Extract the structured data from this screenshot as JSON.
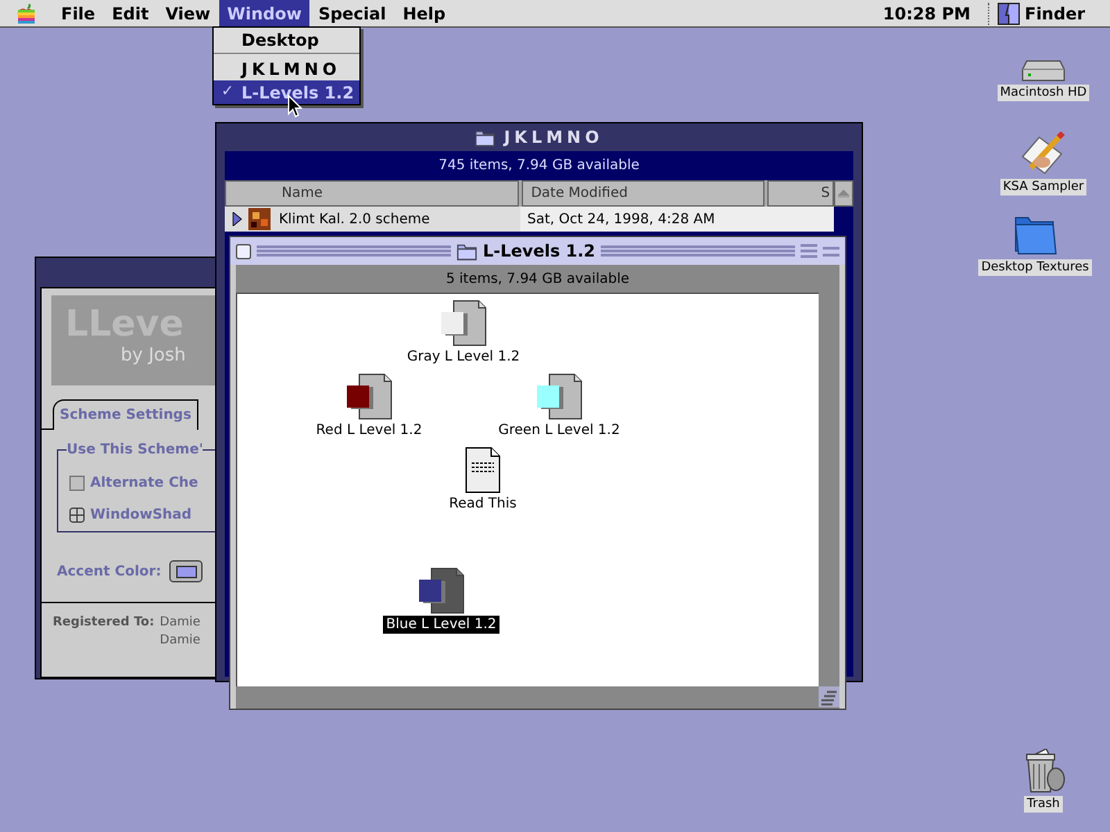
{
  "menu_bar": {
    "items": [
      {
        "label": "File",
        "selected": false
      },
      {
        "label": "Edit",
        "selected": false
      },
      {
        "label": "View",
        "selected": false
      },
      {
        "label": "Window",
        "selected": true
      },
      {
        "label": "Special",
        "selected": false
      },
      {
        "label": "Help",
        "selected": false
      }
    ],
    "clock": "10:28 PM",
    "app": "Finder"
  },
  "window_menu": {
    "items": [
      {
        "kind": "item",
        "label": "Desktop",
        "checked": false,
        "selected": false
      },
      {
        "kind": "separator"
      },
      {
        "kind": "item",
        "label": "JKLMNO",
        "checked": false,
        "selected": false
      },
      {
        "kind": "item",
        "label": "L-Levels 1.2",
        "checked": true,
        "selected": true
      }
    ],
    "check_mark": "✓"
  },
  "control_panel": {
    "logo_title": "LLeve",
    "logo_byline": "by Josh",
    "tab": "Scheme Settings",
    "group_label": "Use This Scheme'",
    "options": [
      {
        "kind": "checkbox",
        "label": "Alternate Che",
        "checked": false
      },
      {
        "kind": "collapse",
        "label": "WindowShad"
      }
    ],
    "accent_label": "Accent Color:",
    "registered_label": "Registered To:",
    "registered_lines": [
      "Damie",
      "Damie"
    ]
  },
  "list_window": {
    "title": "JKLMNO",
    "info": "745 items, 7.94 GB available",
    "columns": [
      "Name",
      "Date Modified",
      "S"
    ],
    "rows": [
      {
        "name": "Klimt Kal. 2.0 scheme",
        "date": "Sat, Oct 24, 1998, 4:28 AM",
        "expanded": false
      }
    ]
  },
  "icon_window": {
    "title": "L-Levels 1.2",
    "info": "5 items, 7.94 GB available",
    "items": [
      {
        "kind": "scheme",
        "name": "Gray L Level 1.2",
        "color": "#eeeeee",
        "selected": false
      },
      {
        "kind": "scheme",
        "name": "Red L Level 1.2",
        "color": "#770000",
        "selected": false
      },
      {
        "kind": "scheme",
        "name": "Green L Level 1.2",
        "color": "#99ffff",
        "selected": false
      },
      {
        "kind": "document",
        "name": "Read This",
        "selected": false
      },
      {
        "kind": "scheme",
        "name": "Blue L Level 1.2",
        "color": "#333388",
        "selected": true
      }
    ]
  },
  "desktop_icons": [
    {
      "kind": "disk",
      "label": "Macintosh HD"
    },
    {
      "kind": "app",
      "label": "KSA Sampler"
    },
    {
      "kind": "folder",
      "label": "Desktop Textures"
    },
    {
      "kind": "trash",
      "label": "Trash"
    }
  ]
}
